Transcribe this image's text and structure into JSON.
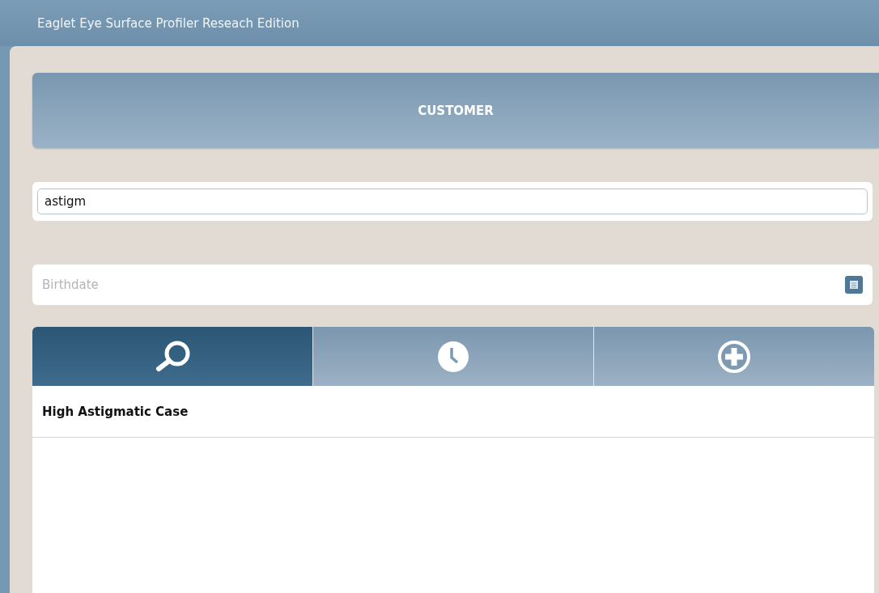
{
  "window": {
    "title": "Eaglet Eye Surface Profiler Reseach Edition"
  },
  "header": {
    "title": "CUSTOMER"
  },
  "search": {
    "value": "astigm"
  },
  "birthdate": {
    "placeholder": "Birthdate"
  },
  "tabs": [
    {
      "kind": "search",
      "selected": true
    },
    {
      "kind": "history",
      "selected": false
    },
    {
      "kind": "add",
      "selected": false
    }
  ],
  "results": [
    {
      "label": "High Astigmatic Case"
    }
  ]
}
